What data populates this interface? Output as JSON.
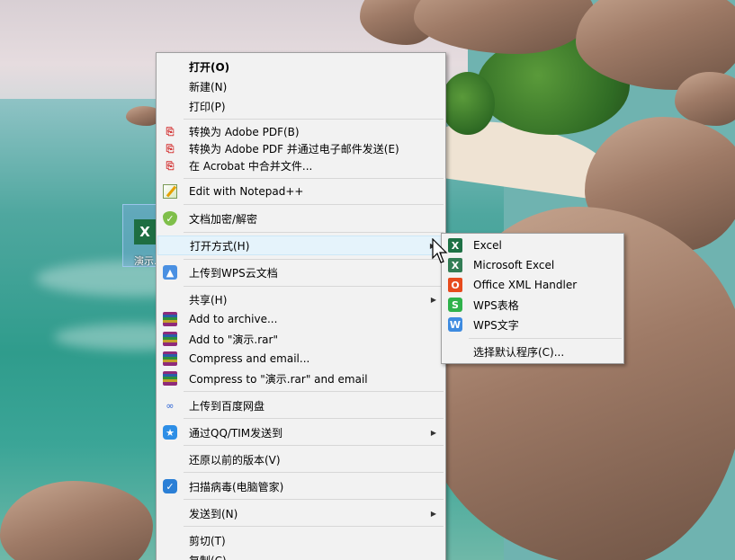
{
  "desktop": {
    "file_icon_glyph": "X",
    "file_name": "演示..."
  },
  "context_menu": {
    "items": [
      {
        "label": "打开(O)",
        "bold": true
      },
      {
        "label": "新建(N)"
      },
      {
        "label": "打印(P)"
      },
      {
        "label": "转换为 Adobe PDF(B)",
        "icon": "adobe-pdf-icon"
      },
      {
        "label": "转换为 Adobe PDF 并通过电子邮件发送(E)",
        "icon": "adobe-pdf-email-icon"
      },
      {
        "label": "在 Acrobat 中合并文件...",
        "icon": "acrobat-combine-icon"
      },
      {
        "label": "Edit with Notepad++",
        "icon": "notepad-plus-plus-icon"
      },
      {
        "label": "文档加密/解密",
        "icon": "shield-icon"
      },
      {
        "label": "打开方式(H)",
        "has_submenu": true,
        "highlighted": true
      },
      {
        "label": "上传到WPS云文档",
        "icon": "wps-cloud-icon"
      },
      {
        "label": "共享(H)",
        "has_submenu": true
      },
      {
        "label": "Add to archive...",
        "icon": "winrar-icon"
      },
      {
        "label": "Add to \"演示.rar\"",
        "icon": "winrar-icon"
      },
      {
        "label": "Compress and email...",
        "icon": "winrar-icon"
      },
      {
        "label": "Compress to \"演示.rar\" and email",
        "icon": "winrar-icon"
      },
      {
        "label": "上传到百度网盘",
        "icon": "baidu-netdisk-icon"
      },
      {
        "label": "通过QQ/TIM发送到",
        "icon": "qq-icon",
        "has_submenu": true
      },
      {
        "label": "还原以前的版本(V)"
      },
      {
        "label": "扫描病毒(电脑管家)",
        "icon": "pc-manager-icon"
      },
      {
        "label": "发送到(N)",
        "has_submenu": true
      },
      {
        "label": "剪切(T)"
      },
      {
        "label": "复制(C)"
      }
    ]
  },
  "open_with_submenu": {
    "items": [
      {
        "label": "Excel",
        "icon": "excel-icon"
      },
      {
        "label": "Microsoft Excel",
        "icon": "microsoft-excel-icon"
      },
      {
        "label": "Office XML Handler",
        "icon": "office-icon"
      },
      {
        "label": "WPS表格",
        "icon": "wps-spreadsheet-icon"
      },
      {
        "label": "WPS文字",
        "icon": "wps-writer-icon"
      },
      {
        "label": "选择默认程序(C)..."
      }
    ]
  },
  "submenu_arrow_glyph": "▶"
}
